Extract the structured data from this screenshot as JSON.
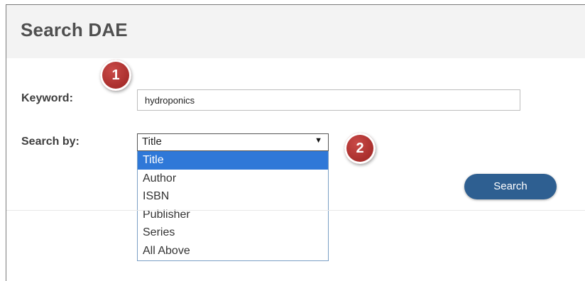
{
  "page": {
    "title": "Search DAE"
  },
  "form": {
    "keyword_label": "Keyword:",
    "keyword_value": "hydroponics",
    "search_by_label": "Search by:",
    "search_by_selected": "Title",
    "search_by_options": [
      "Title",
      "Author",
      "ISBN",
      "Publisher",
      "Series",
      "All Above"
    ],
    "search_button": "Search"
  },
  "annotations": {
    "step1": "1",
    "step2": "2"
  },
  "colors": {
    "button": "#2e5f91",
    "highlight": "#2f78d8",
    "badge": "#b33a38",
    "header_bg": "#f3f3f3"
  }
}
